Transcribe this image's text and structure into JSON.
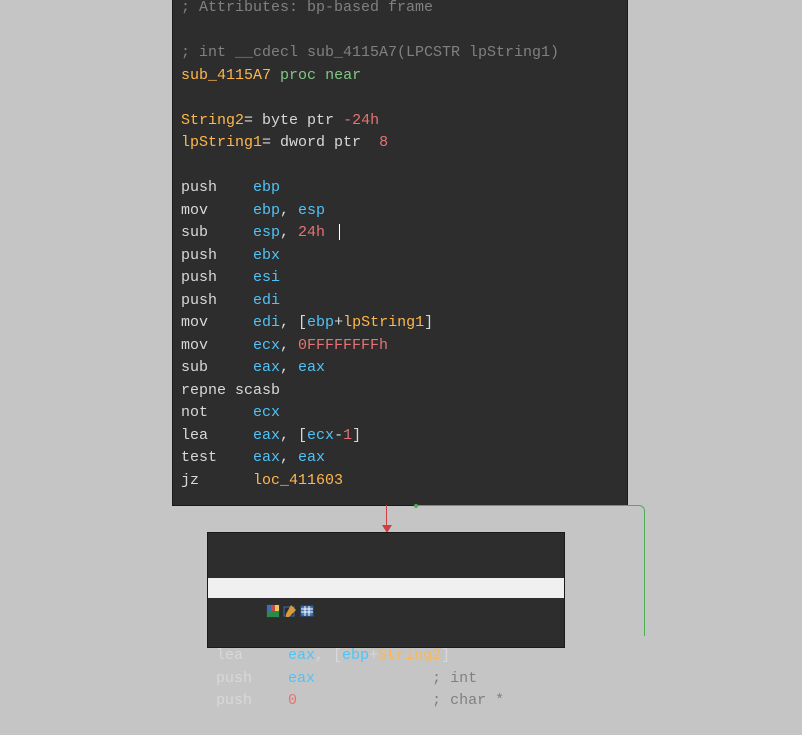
{
  "box1": {
    "comment1": "; Attributes: bp-based frame",
    "comment2": "; int __cdecl sub_4115A7(LPCSTR lpString1)",
    "proc_label": "sub_4115A7",
    "proc_kw1": "proc",
    "proc_kw2": "near",
    "vars": [
      {
        "name": "String2",
        "eq": "=",
        "type": "byte ptr",
        "off": "-24h"
      },
      {
        "name": "lpString1",
        "eq": "=",
        "type": "dword ptr",
        "off": "8"
      }
    ],
    "instr": [
      {
        "op": "push",
        "t": [
          {
            "c": "reg",
            "v": "ebp"
          }
        ]
      },
      {
        "op": "mov",
        "t": [
          {
            "c": "reg",
            "v": "ebp"
          },
          {
            "c": "p",
            "v": ", "
          },
          {
            "c": "reg",
            "v": "esp"
          }
        ]
      },
      {
        "op": "sub",
        "t": [
          {
            "c": "reg",
            "v": "esp"
          },
          {
            "c": "p",
            "v": ", "
          },
          {
            "c": "num",
            "v": "24h"
          }
        ],
        "cursor": true
      },
      {
        "op": "push",
        "t": [
          {
            "c": "reg",
            "v": "ebx"
          }
        ]
      },
      {
        "op": "push",
        "t": [
          {
            "c": "reg",
            "v": "esi"
          }
        ]
      },
      {
        "op": "push",
        "t": [
          {
            "c": "reg",
            "v": "edi"
          }
        ]
      },
      {
        "op": "mov",
        "t": [
          {
            "c": "reg",
            "v": "edi"
          },
          {
            "c": "p",
            "v": ", ["
          },
          {
            "c": "reg",
            "v": "ebp"
          },
          {
            "c": "p",
            "v": "+"
          },
          {
            "c": "label",
            "v": "lpString1"
          },
          {
            "c": "p",
            "v": "]"
          }
        ]
      },
      {
        "op": "mov",
        "t": [
          {
            "c": "reg",
            "v": "ecx"
          },
          {
            "c": "p",
            "v": ", "
          },
          {
            "c": "num",
            "v": "0FFFFFFFFh"
          }
        ]
      },
      {
        "op": "sub",
        "t": [
          {
            "c": "reg",
            "v": "eax"
          },
          {
            "c": "p",
            "v": ", "
          },
          {
            "c": "reg",
            "v": "eax"
          }
        ]
      },
      {
        "op": "repne scasb",
        "t": []
      },
      {
        "op": "not",
        "t": [
          {
            "c": "reg",
            "v": "ecx"
          }
        ]
      },
      {
        "op": "lea",
        "t": [
          {
            "c": "reg",
            "v": "eax"
          },
          {
            "c": "p",
            "v": ", ["
          },
          {
            "c": "reg",
            "v": "ecx"
          },
          {
            "c": "p",
            "v": "-"
          },
          {
            "c": "num",
            "v": "1"
          },
          {
            "c": "p",
            "v": "]"
          }
        ]
      },
      {
        "op": "test",
        "t": [
          {
            "c": "reg",
            "v": "eax"
          },
          {
            "c": "p",
            "v": ", "
          },
          {
            "c": "reg",
            "v": "eax"
          }
        ]
      },
      {
        "op": "jz",
        "t": [
          {
            "c": "label",
            "v": "loc_411603"
          }
        ]
      }
    ]
  },
  "box2": {
    "instr": [
      {
        "op": "lea",
        "t": [
          {
            "c": "reg",
            "v": "eax"
          },
          {
            "c": "p",
            "v": ", ["
          },
          {
            "c": "reg",
            "v": "ebp"
          },
          {
            "c": "p",
            "v": "+"
          },
          {
            "c": "label",
            "v": "String2"
          },
          {
            "c": "p",
            "v": "]"
          }
        ]
      },
      {
        "op": "push",
        "t": [
          {
            "c": "reg",
            "v": "eax"
          }
        ],
        "tail": {
          "c": "comment",
          "v": "; int"
        },
        "tailcol": 24
      },
      {
        "op": "push",
        "t": [
          {
            "c": "num",
            "v": "0"
          }
        ],
        "tail": {
          "c": "comment",
          "v": "; char *"
        },
        "tailcol": 24
      }
    ]
  },
  "colors": {
    "bg_canvas": "#c5c5c5",
    "bg_code": "#2d2d2d",
    "comment": "#808080",
    "register": "#4fc3f7",
    "number": "#e57373",
    "label": "#ffb74d",
    "keyword": "#81c784",
    "text": "#d8d8d8",
    "arrow_false": "#d04040",
    "arrow_true": "#4caf50"
  }
}
